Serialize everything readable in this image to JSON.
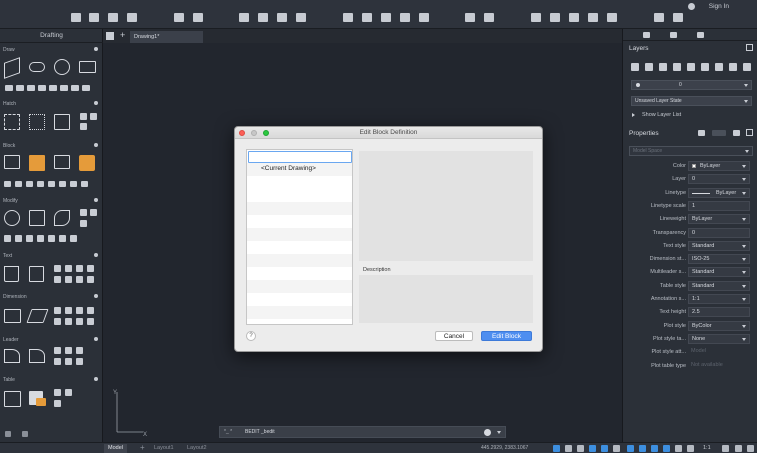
{
  "header": {
    "signin_label": "Sign In"
  },
  "left_palette": {
    "title": "Drafting",
    "sections": [
      "Draw",
      "Hatch",
      "Block",
      "Modify",
      "Text",
      "Dimension",
      "Leader",
      "Table"
    ]
  },
  "drawing_tabs": {
    "active": "Drawing1*"
  },
  "command_line": {
    "prompt": "*_ *",
    "text": "BEDIT _bedit"
  },
  "status_bar": {
    "model_tab": "Model",
    "layout1_tab": "Layout1",
    "layout2_tab": "Layout2",
    "coordinates": "445.2929, 2383.1067",
    "scale": "1:1"
  },
  "layers_panel": {
    "title": "Layers",
    "current_layer": "0",
    "layer_state": "Unsaved Layer State",
    "show_layer_list": "Show Layer List"
  },
  "properties_panel": {
    "title": "Properties",
    "selection": "Model Space",
    "rows": [
      {
        "label": "Color",
        "value": "ByLayer"
      },
      {
        "label": "Layer",
        "value": "0"
      },
      {
        "label": "Linetype",
        "value": "ByLayer"
      },
      {
        "label": "Linetype scale",
        "value": "1"
      },
      {
        "label": "Lineweight",
        "value": "ByLayer"
      },
      {
        "label": "Transparency",
        "value": "0"
      },
      {
        "label": "Text style",
        "value": "Standard"
      },
      {
        "label": "Dimension st...",
        "value": "ISO-25"
      },
      {
        "label": "Multileader s...",
        "value": "Standard"
      },
      {
        "label": "Table style",
        "value": "Standard"
      },
      {
        "label": "Annotation s...",
        "value": "1:1"
      },
      {
        "label": "Text height",
        "value": "2.5"
      },
      {
        "label": "Plot style",
        "value": "ByColor"
      },
      {
        "label": "Plot style ta...",
        "value": "None"
      },
      {
        "label": "Plot style att...",
        "value": "Model"
      },
      {
        "label": "Plot table type",
        "value": "Not available"
      }
    ]
  },
  "dialog": {
    "title": "Edit Block Definition",
    "name_value": "",
    "list_items": [
      "<Current Drawing>"
    ],
    "description_label": "Description",
    "help_label": "?",
    "cancel_label": "Cancel",
    "edit_label": "Edit Block"
  }
}
